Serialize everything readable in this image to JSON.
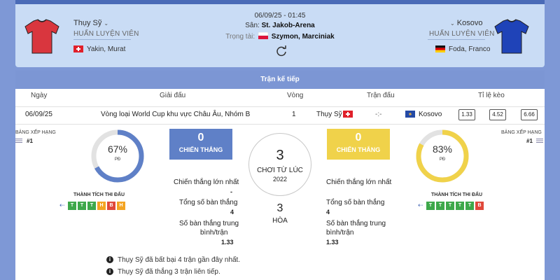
{
  "match": {
    "datetime": "06/09/25 - 01:45",
    "stadium_label": "Sân:",
    "stadium": "St. Jakob-Arena",
    "referee_label": "Trọng tài:",
    "referee": "Szymon, Marciniak"
  },
  "home": {
    "name": "Thụy Sỹ",
    "coach_label": "HUẤN LUYỆN VIÊN",
    "coach": "Yakin, Murat",
    "color": "#d9363e"
  },
  "away": {
    "name": "Kosovo",
    "coach_label": "HUẤN LUYỆN VIÊN",
    "coach": "Foda, Franco",
    "color": "#1f43b8"
  },
  "next_match": {
    "title": "Trận kế tiếp",
    "headers": [
      "Ngày",
      "Giải đấu",
      "Vòng",
      "Trận đấu",
      "Tỉ lệ kèo"
    ],
    "date": "06/09/25",
    "competition": "Vòng loại World Cup khu vực Châu Âu, Nhóm B",
    "round": "1",
    "home": "Thụy Sỹ",
    "score": "-:-",
    "away": "Kosovo",
    "odds": [
      "1.33",
      "4.52",
      "6.66"
    ]
  },
  "left_panel": {
    "rank_label": "BẢNG XẾP HẠNG",
    "rank": "#1",
    "percent_text": "67%",
    "percent": 0.67,
    "pd": "PĐ",
    "perf_label": "THÀNH TÍCH THI ĐẤU",
    "form": [
      "T",
      "T",
      "T",
      "H",
      "B",
      "H"
    ],
    "wins_value": "0",
    "wins_label": "CHIẾN THẮNG",
    "box_color": "#5f80c7",
    "ring_color": "#5f80c7"
  },
  "right_panel": {
    "rank_label": "BẢNG XẾP HẠNG",
    "rank": "#1",
    "percent_text": "83%",
    "percent": 0.83,
    "pd": "PĐ",
    "perf_label": "THÀNH TÍCH THI ĐẤU",
    "form": [
      "T",
      "T",
      "T",
      "T",
      "T",
      "B"
    ],
    "wins_value": "0",
    "wins_label": "CHIẾN THẮNG",
    "box_color": "#f0d24a",
    "ring_color": "#f0d24a"
  },
  "form_colors": {
    "T": "#3ea84a",
    "H": "#f4a422",
    "B": "#e0483a"
  },
  "center": {
    "played": "3",
    "played_label": "CHƠI TỪ LÚC",
    "since": "2022",
    "draws": "3",
    "draws_label": "HÒA"
  },
  "stats": {
    "biggest_win_label": "Chiến thắng lớn nhất",
    "biggest_win_home": "-",
    "total_goals_label": "Tổng số bàn thắng",
    "total_goals_home": "4",
    "total_goals_away": "4",
    "avg_goals_label_1": "Số bàn thắng trung",
    "avg_goals_label_2": "bình/trận",
    "avg_goals_home": "1.33",
    "avg_goals_away": "1.33"
  },
  "notes": [
    "Thụy Sỹ đã bất bại 4 trận gần đây nhất.",
    "Thụy Sỹ đã thắng 3 trận liên tiếp."
  ]
}
